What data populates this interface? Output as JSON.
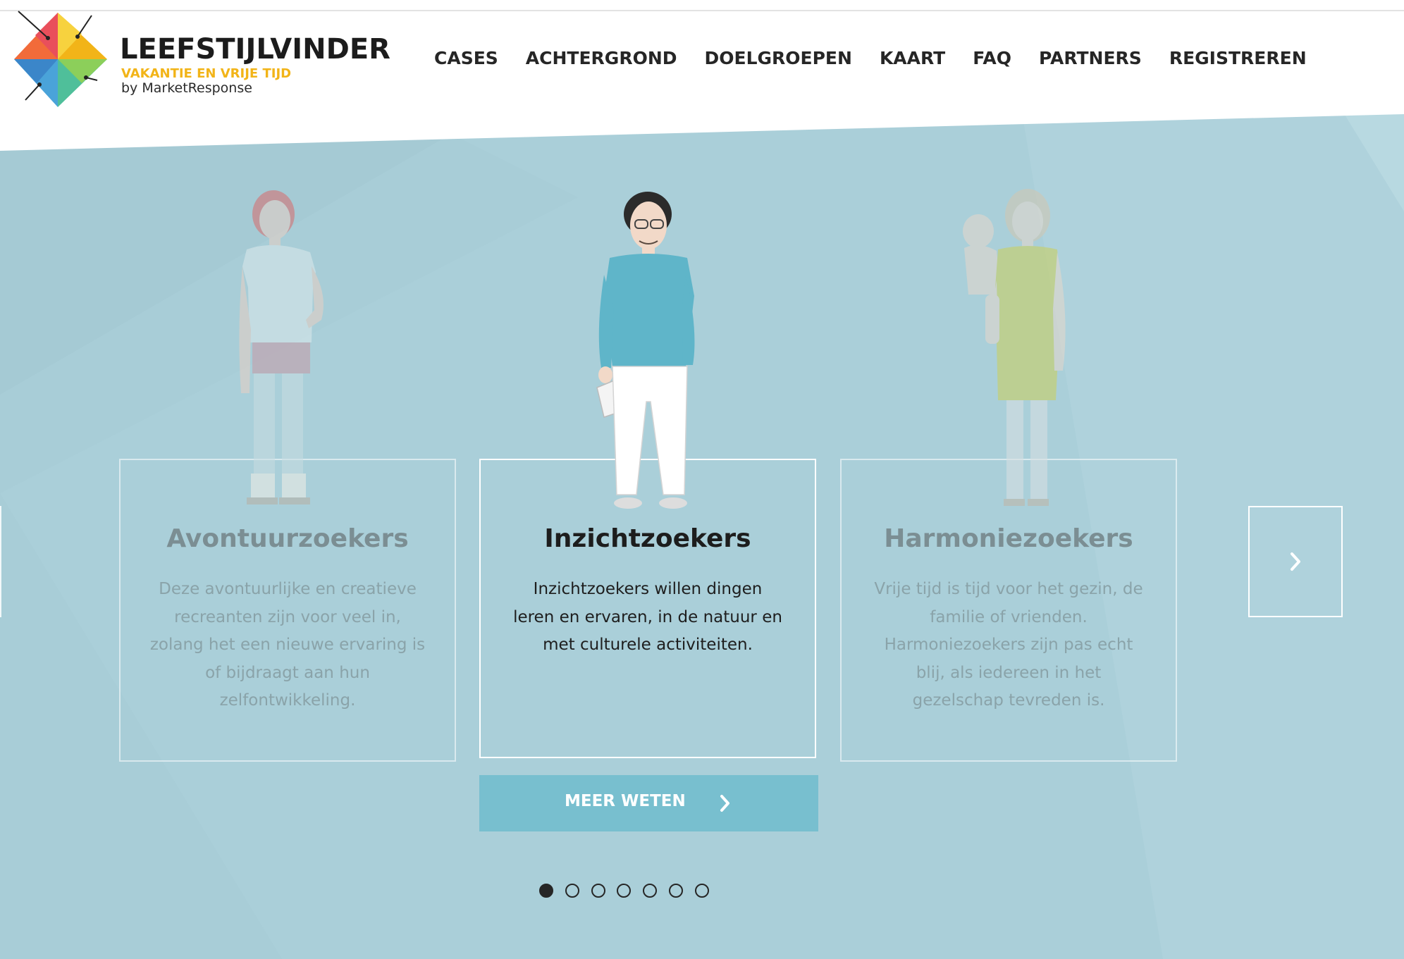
{
  "brand": {
    "name": "LEEFSTIJLVINDER",
    "subtitle": "VAKANTIE EN VRIJE TIJD",
    "byline": "by MarketResponse"
  },
  "nav": {
    "items": [
      "CASES",
      "ACHTERGROND",
      "DOELGROEPEN",
      "KAART",
      "FAQ",
      "PARTNERS",
      "REGISTREREN"
    ]
  },
  "carousel": {
    "cards": [
      {
        "title": "Avontuurzoekers",
        "text": "Deze avontuurlijke en creatieve recreanten zijn voor veel in, zolang het een nieuwe ervaring is of bijdraagt aan hun zelfontwikkeling."
      },
      {
        "title": "Inzichtzoekers",
        "text": "Inzichtzoekers willen dingen leren en ervaren, in de natuur en met culturele activiteiten."
      },
      {
        "title": "Harmoniezoekers",
        "text": "Vrije tijd is tijd voor het gezin, de familie of vrienden. Harmoniezoekers zijn pas echt blij, als iedereen in het gezelschap tevreden is."
      }
    ],
    "active_index": 1,
    "cta_label": "MEER WETEN",
    "page_count": 7,
    "current_page": 1
  },
  "icons": {
    "next": "chevron-right-icon",
    "cta": "chevron-right-icon",
    "logo": "diamond-logo-icon"
  },
  "colors": {
    "hero_bg": "#aacfd9",
    "cta_bg": "#78bfcf",
    "brand_accent": "#f2b418",
    "text_dark": "#1d1d1d"
  }
}
